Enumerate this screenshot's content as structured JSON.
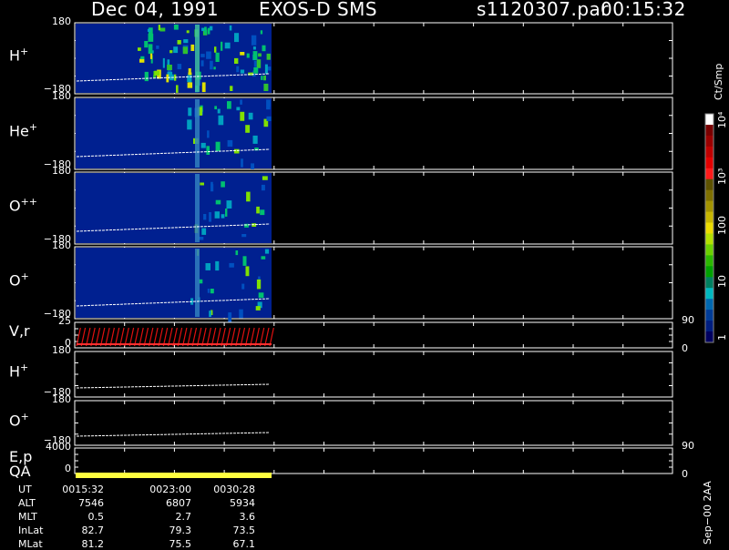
{
  "header": {
    "date": "Dec 04, 1991",
    "instrument": "EXOS-D SMS",
    "file": "s1120307.par",
    "time": "00:15:32"
  },
  "panels": [
    {
      "label_main": "H",
      "label_sup": "+",
      "top_tick": "180",
      "bottom_tick": "−180"
    },
    {
      "label_main": "He",
      "label_sup": "+",
      "top_tick": "180",
      "bottom_tick": "−180"
    },
    {
      "label_main": "O",
      "label_sup": "++",
      "top_tick": "180",
      "bottom_tick": "−180"
    },
    {
      "label_main": "O",
      "label_sup": "+",
      "top_tick": "180",
      "bottom_tick": "−180"
    },
    {
      "label_main": "V,r",
      "label_sup": "",
      "top_tick": "25",
      "bottom_tick": "0",
      "right_top": "90",
      "right_bottom": "0"
    },
    {
      "label_main": "H",
      "label_sup": "+",
      "top_tick": "180",
      "bottom_tick": "−180"
    },
    {
      "label_main": "O",
      "label_sup": "+",
      "top_tick": "180",
      "bottom_tick": "−180"
    },
    {
      "label_main": "E,p",
      "label_sup": "",
      "top_tick": "4000",
      "bottom_tick": "0",
      "right_top": "90",
      "right_bottom": "0"
    }
  ],
  "qa_label": "QA",
  "colorbar": {
    "unit": "Ct/Smp",
    "tick_labels": [
      "10⁴",
      "10³",
      "100",
      "10",
      "1"
    ],
    "colors": [
      "#ffffff",
      "#7a0000",
      "#9b0000",
      "#bf0000",
      "#e30000",
      "#ff1a1a",
      "#5e5200",
      "#7f7000",
      "#a39300",
      "#c7b600",
      "#ecdc00",
      "#b4e000",
      "#6cd000",
      "#2cb800",
      "#00a000",
      "#008060",
      "#00b8c0",
      "#0068b0",
      "#003c98",
      "#001e80",
      "#000060"
    ]
  },
  "ephemeris": {
    "labels": [
      "UT",
      "ALT",
      "MLT",
      "InLat",
      "MLat"
    ],
    "columns": [
      [
        "0015:32",
        "7546",
        "0.5",
        "82.7",
        "81.2"
      ],
      [
        "0023:00",
        "6807",
        "2.7",
        "79.3",
        "75.5"
      ],
      [
        "0030:28",
        "5934",
        "3.6",
        "73.5",
        "67.1"
      ]
    ]
  },
  "footer_right": "Sep−00 2AA",
  "chart_data": {
    "type": "heatmap",
    "x_time_range": [
      "00:15:32",
      "00:30:28"
    ],
    "series": [
      {
        "name": "H+",
        "ylim": [
          -180,
          180
        ]
      },
      {
        "name": "He+",
        "ylim": [
          -180,
          180
        ]
      },
      {
        "name": "O++",
        "ylim": [
          -180,
          180
        ]
      },
      {
        "name": "O+",
        "ylim": [
          -180,
          180
        ]
      },
      {
        "name": "V,r",
        "ylim": [
          0,
          25
        ]
      },
      {
        "name": "H+",
        "ylim": [
          -180,
          180
        ]
      },
      {
        "name": "O+",
        "ylim": [
          -180,
          180
        ]
      },
      {
        "name": "E,p",
        "ylim": [
          0,
          4000
        ]
      }
    ],
    "colorbar_range": [
      1,
      10000
    ],
    "colorbar_scale": "log"
  }
}
